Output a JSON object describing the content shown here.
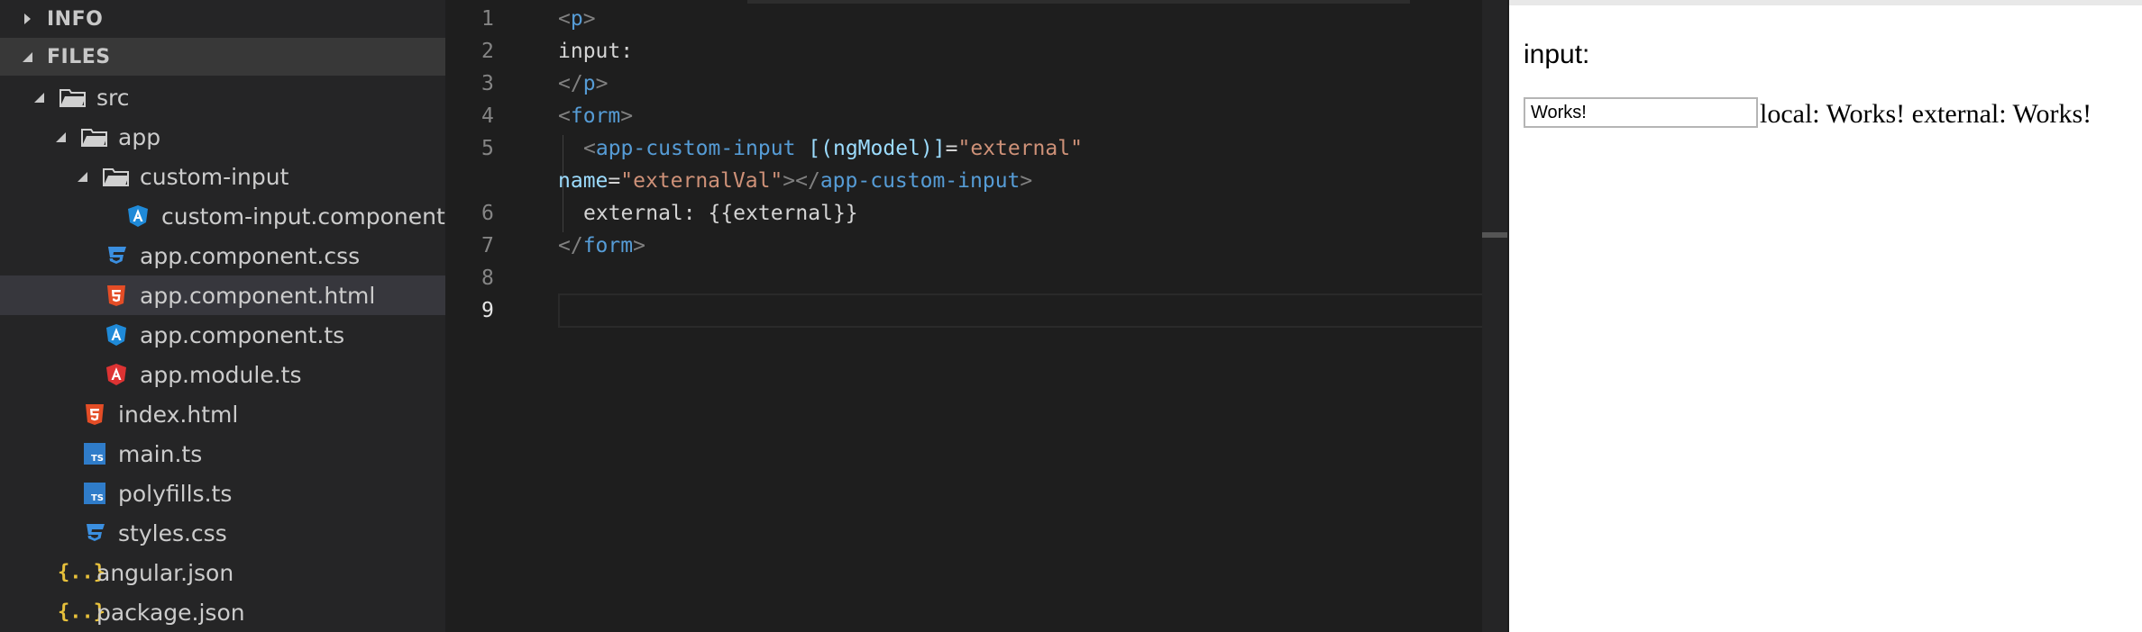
{
  "sidebar": {
    "sections": [
      {
        "label": "INFO",
        "expanded": false
      },
      {
        "label": "FILES",
        "expanded": true
      }
    ],
    "tree": [
      {
        "label": "src",
        "type": "folder"
      },
      {
        "label": "app",
        "type": "folder"
      },
      {
        "label": "custom-input",
        "type": "folder"
      },
      {
        "label": "custom-input.component.ts",
        "type": "angular-ts"
      },
      {
        "label": "app.component.css",
        "type": "css"
      },
      {
        "label": "app.component.html",
        "type": "html",
        "selected": true
      },
      {
        "label": "app.component.ts",
        "type": "angular-ts"
      },
      {
        "label": "app.module.ts",
        "type": "angular-module"
      },
      {
        "label": "index.html",
        "type": "html"
      },
      {
        "label": "main.ts",
        "type": "ts"
      },
      {
        "label": "polyfills.ts",
        "type": "ts"
      },
      {
        "label": "styles.css",
        "type": "css"
      },
      {
        "label": "angular.json",
        "type": "json"
      },
      {
        "label": "package.json",
        "type": "json"
      }
    ],
    "icons": {
      "ts_badge": "TS",
      "json_glyph": "{..}"
    }
  },
  "editor": {
    "line_numbers": [
      "1",
      "2",
      "3",
      "4",
      "5",
      "6",
      "7",
      "8",
      "9"
    ],
    "current_line": "9",
    "code": {
      "l1_open": "<",
      "l1_tag": "p",
      "l1_close": ">",
      "l2_text": "input:",
      "l3_open": "</",
      "l3_tag": "p",
      "l3_close": ">",
      "l4_open": "<",
      "l4_tag": "form",
      "l4_close": ">",
      "l5_open": "<",
      "l5_tag": "app-custom-input",
      "l5_attr": "[(ngModel)]",
      "l5_eq": "=",
      "l5_val": "\"external\"",
      "l5b_attr": "name",
      "l5b_eq": "=",
      "l5b_val": "\"externalVal\"",
      "l5b_gt": ">",
      "l5b_close_open": "</",
      "l5b_close_tag": "app-custom-input",
      "l5b_close_gt": ">",
      "l6_text": "external: {{external}}",
      "l7_open": "</",
      "l7_tag": "form",
      "l7_close": ">"
    }
  },
  "preview": {
    "label": "input:",
    "input_value": "Works!",
    "output_text": "local: Works! external: Works!"
  },
  "colors": {
    "sidebar_bg": "#252526",
    "editor_bg": "#1e1e1e",
    "tag": "#569cd6",
    "attr": "#9cdcfe",
    "string": "#ce9178",
    "css_icon": "#3b8fe0",
    "html_icon": "#e44d26",
    "angular_icon": "#1f8ad8",
    "angular_module_icon": "#dd3333",
    "json_icon": "#e8c13b"
  }
}
